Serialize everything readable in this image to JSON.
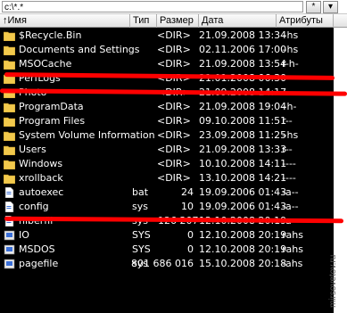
{
  "path": "c:\\*.*",
  "toolbar": {
    "star_label": "*",
    "down_label": "▾"
  },
  "columns": {
    "name": "↑Имя",
    "type": "Тип",
    "size": "Размер",
    "date": "Дата",
    "attr": "Атрибуты"
  },
  "rows": [
    {
      "icon": "folder-icon",
      "name": "$Recycle.Bin",
      "type": "",
      "size": "<DIR>",
      "date": "21.09.2008 13:34",
      "attr": "–hs"
    },
    {
      "icon": "folder-icon",
      "name": "Documents and Settings",
      "type": "",
      "size": "<DIR>",
      "date": "02.11.2006 17:00",
      "attr": "–hs"
    },
    {
      "icon": "folder-icon",
      "name": "MSOCache",
      "type": "",
      "size": "<DIR>",
      "date": "21.09.2008 13:54",
      "attr": "r-h-"
    },
    {
      "icon": "folder-icon",
      "name": "PerfLogs",
      "type": "",
      "size": "<DIR>",
      "date": "21.01.2008 06:30",
      "attr": "----"
    },
    {
      "icon": "folder-icon",
      "name": "Photo",
      "type": "",
      "size": "<DIR>",
      "date": "21.09.2008 14:17",
      "attr": "----"
    },
    {
      "icon": "folder-icon",
      "name": "ProgramData",
      "type": "",
      "size": "<DIR>",
      "date": "21.09.2008 19:04",
      "attr": "–h-"
    },
    {
      "icon": "folder-icon",
      "name": "Program Files",
      "type": "",
      "size": "<DIR>",
      "date": "09.10.2008 11:51",
      "attr": "r--"
    },
    {
      "icon": "folder-icon",
      "name": "System Volume Information",
      "type": "",
      "size": "<DIR>",
      "date": "23.09.2008 11:25",
      "attr": "–hs"
    },
    {
      "icon": "folder-icon",
      "name": "Users",
      "type": "",
      "size": "<DIR>",
      "date": "21.09.2008 13:33",
      "attr": "r--"
    },
    {
      "icon": "folder-icon",
      "name": "Windows",
      "type": "",
      "size": "<DIR>",
      "date": "10.10.2008 14:11",
      "attr": "----"
    },
    {
      "icon": "folder-icon",
      "name": "xrollback",
      "type": "",
      "size": "<DIR>",
      "date": "13.10.2008 14:21",
      "attr": "----"
    },
    {
      "icon": "file-icon",
      "name": "autoexec",
      "type": "bat",
      "size": "24",
      "date": "19.09.2006 01:43",
      "attr": "-a--"
    },
    {
      "icon": "file-icon",
      "name": "config",
      "type": "sys",
      "size": "10",
      "date": "19.09.2006 01:43",
      "attr": "-a--"
    },
    {
      "icon": "file-icon",
      "name": "hiberfil",
      "type": "sys",
      "size": "126 207",
      "date": "12.10.2008 20:19",
      "attr": "-a--"
    },
    {
      "icon": "system-file-icon",
      "name": "IO",
      "type": "SYS",
      "size": "0",
      "date": "12.10.2008 20:19",
      "attr": "rahs"
    },
    {
      "icon": "system-file-icon",
      "name": "MSDOS",
      "type": "SYS",
      "size": "0",
      "date": "12.10.2008 20:19",
      "attr": "rahs"
    },
    {
      "icon": "system-file-icon",
      "name": "pagefile",
      "type": "sys",
      "size": "801 686 016",
      "date": "15.10.2008 20:18",
      "attr": "-ahs"
    }
  ],
  "watermark": "mirsovetov.ru"
}
